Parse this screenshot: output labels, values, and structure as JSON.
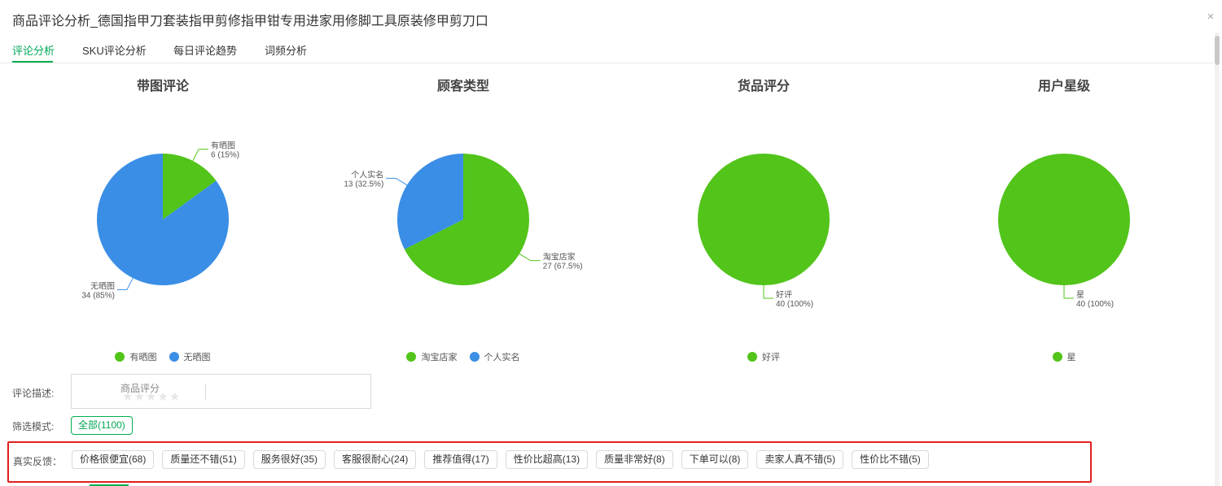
{
  "title": "商品评论分析_德国指甲刀套装指甲剪修指甲钳专用进家用修脚工具原装修甲剪刀口",
  "close_label": "×",
  "tabs": [
    {
      "label": "评论分析",
      "active": true
    },
    {
      "label": "SKU评论分析",
      "active": false
    },
    {
      "label": "每日评论趋势",
      "active": false
    },
    {
      "label": "词频分析",
      "active": false
    }
  ],
  "colors": {
    "green": "#52c41a",
    "blue": "#3a8ee6",
    "accent": "#00b050",
    "highlight_border": "#e02020"
  },
  "chart_data": [
    {
      "type": "pie",
      "title": "带图评论",
      "slices": [
        {
          "name": "有晒图",
          "value": 6,
          "percent": "15%",
          "color": "#52c41a"
        },
        {
          "name": "无晒图",
          "value": 34,
          "percent": "85%",
          "color": "#3a8ee6"
        }
      ],
      "legend": "bottom"
    },
    {
      "type": "pie",
      "title": "顾客类型",
      "slices": [
        {
          "name": "淘宝店家",
          "value": 27,
          "percent": "67.5%",
          "color": "#52c41a"
        },
        {
          "name": "个人实名",
          "value": 13,
          "percent": "32.5%",
          "color": "#3a8ee6"
        }
      ],
      "legend": "bottom"
    },
    {
      "type": "pie",
      "title": "货品评分",
      "slices": [
        {
          "name": "好评",
          "value": 40,
          "percent": "100%",
          "color": "#52c41a"
        }
      ],
      "legend": "bottom"
    },
    {
      "type": "pie",
      "title": "用户星级",
      "slices": [
        {
          "name": "星",
          "value": 40,
          "percent": "100%",
          "color": "#52c41a"
        }
      ],
      "legend": "bottom"
    }
  ],
  "review_description": {
    "label": "评论描述:",
    "rating_title": "商品评分",
    "stars": "★★★★★",
    "rating_value": 0
  },
  "filter_mode": {
    "label": "筛选模式:",
    "option": "全部(1100)"
  },
  "feedback": {
    "label": "真实反馈：",
    "tags": [
      "价格很便宜(68)",
      "质量还不错(51)",
      "服务很好(35)",
      "客服很耐心(24)",
      "推荐值得(17)",
      "性价比超高(13)",
      "质量非常好(8)",
      "下单可以(8)",
      "卖家人真不错(5)",
      "性价比不错(5)"
    ]
  }
}
